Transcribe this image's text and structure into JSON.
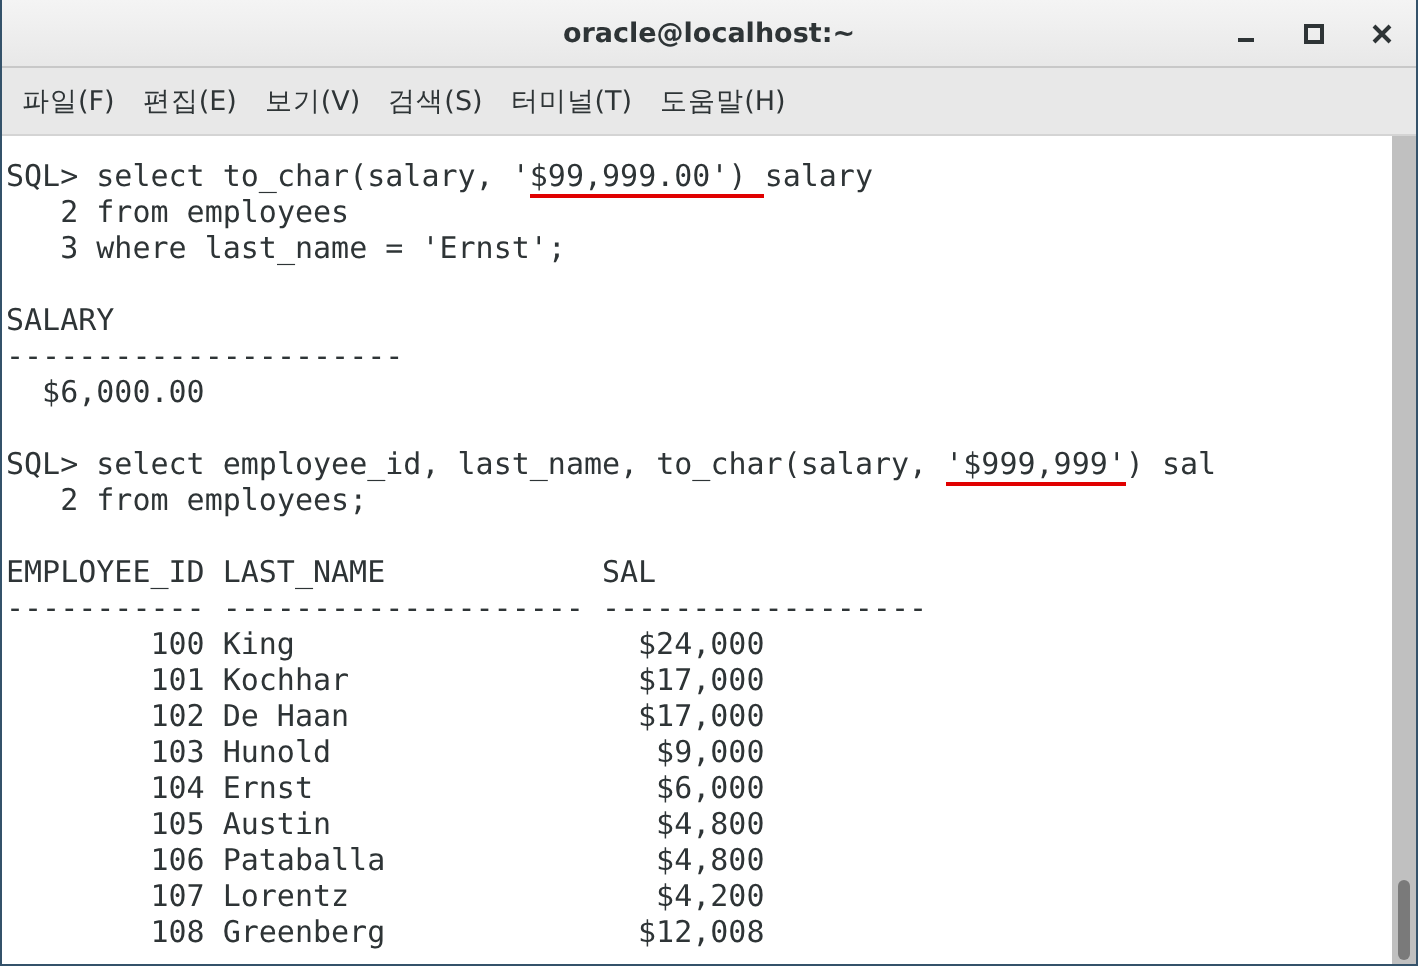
{
  "window": {
    "title": "oracle@localhost:~"
  },
  "menu": [
    {
      "label": "파일(F)"
    },
    {
      "label": "편집(E)"
    },
    {
      "label": "보기(V)"
    },
    {
      "label": "검색(S)"
    },
    {
      "label": "터미널(T)"
    },
    {
      "label": "도움말(H)"
    }
  ],
  "terminal": {
    "lines": [
      {
        "kind": "line",
        "segments": [
          {
            "text": "SQL> select to_char(salary, '",
            "underlined": false
          },
          {
            "text": "$99,999.00') ",
            "underlined": true
          },
          {
            "text": "salary",
            "underlined": false
          }
        ]
      },
      {
        "kind": "line",
        "segments": [
          {
            "text": "   2 from employees",
            "underlined": false
          }
        ]
      },
      {
        "kind": "line",
        "segments": [
          {
            "text": "   3 where last_name = 'Ernst';",
            "underlined": false
          }
        ]
      },
      {
        "kind": "blank"
      },
      {
        "kind": "line",
        "segments": [
          {
            "text": "SALARY",
            "underlined": false
          }
        ]
      },
      {
        "kind": "line",
        "segments": [
          {
            "text": "----------------------",
            "underlined": false
          }
        ]
      },
      {
        "kind": "line",
        "segments": [
          {
            "text": "  $6,000.00",
            "underlined": false
          }
        ]
      },
      {
        "kind": "blank"
      },
      {
        "kind": "line",
        "segments": [
          {
            "text": "SQL> select employee_id, last_name, to_char(salary, ",
            "underlined": false
          },
          {
            "text": "'$999,999'",
            "underlined": true
          },
          {
            "text": ") sal",
            "underlined": false
          }
        ]
      },
      {
        "kind": "line",
        "segments": [
          {
            "text": "   2 from employees;",
            "underlined": false
          }
        ]
      },
      {
        "kind": "blank"
      }
    ],
    "result_table": {
      "columns": [
        "EMPLOYEE_ID",
        "LAST_NAME",
        "SAL"
      ],
      "rules": [
        "-----------",
        "--------------------",
        "------------------"
      ],
      "rows": [
        {
          "id": "100",
          "last_name": "King",
          "sal": "$24,000"
        },
        {
          "id": "101",
          "last_name": "Kochhar",
          "sal": "$17,000"
        },
        {
          "id": "102",
          "last_name": "De Haan",
          "sal": "$17,000"
        },
        {
          "id": "103",
          "last_name": "Hunold",
          "sal": "$9,000"
        },
        {
          "id": "104",
          "last_name": "Ernst",
          "sal": "$6,000"
        },
        {
          "id": "105",
          "last_name": "Austin",
          "sal": "$4,800"
        },
        {
          "id": "106",
          "last_name": "Pataballa",
          "sal": "$4,800"
        },
        {
          "id": "107",
          "last_name": "Lorentz",
          "sal": "$4,200"
        },
        {
          "id": "108",
          "last_name": "Greenberg",
          "sal": "$12,008"
        }
      ]
    }
  }
}
